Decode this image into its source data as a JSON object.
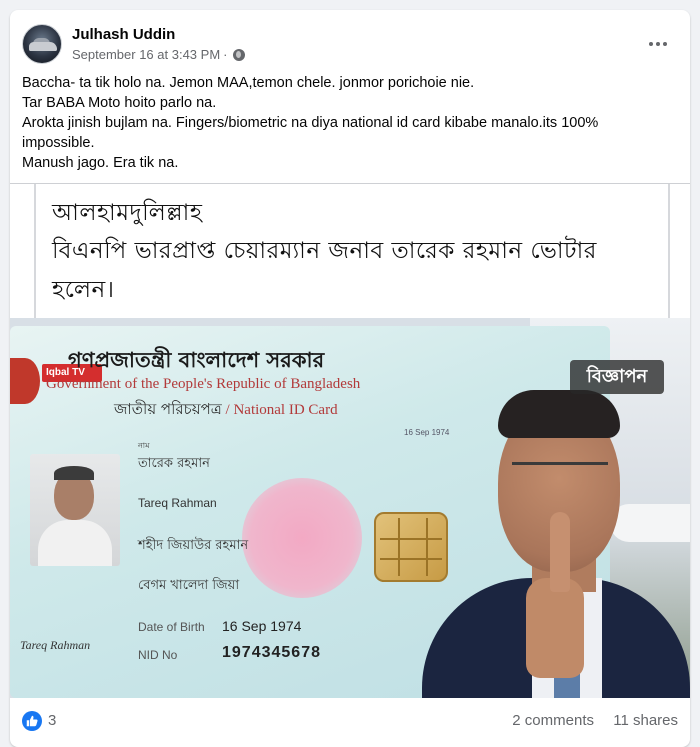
{
  "post": {
    "author": "Julhash Uddin",
    "timestamp": "September 16 at 3:43 PM",
    "separator": "·",
    "privacy_icon": "globe-icon",
    "more_icon": "more-options-icon",
    "text_lines": [
      "Baccha- ta tik holo na. Jemon MAA,temon chele. jonmor porichoie nie.",
      "Tar BABA Moto hoito parlo na.",
      "Arokta jinish bujlam na. Fingers/biometric na diya national id card kibabe manalo.its 100%",
      "impossible.",
      "Manush jago. Era tik na."
    ]
  },
  "image": {
    "headline_lines": [
      "আলহামদুলিল্লাহ",
      "বিএনপি ভারপ্রাপ্ত চেয়ারম্যান জনাব তারেক রহমান ভোটার",
      "হলেন।"
    ],
    "ad_badge": "বিজ্ঞাপন",
    "id_card": {
      "channel_logo": "Iqbal TV",
      "gov_bn": "গণপ্রজাতন্ত্রী বাংলাদেশ সরকার",
      "gov_en": "Government of the People's Republic of Bangladesh",
      "card_title_bn": "জাতীয় পরিচয়পত্র",
      "card_title_en": " / National ID Card",
      "issue_date": "16 Sep 1974",
      "name_label": "নাম",
      "name_bn": "তারেক রহমান",
      "name_en": "Tareq Rahman",
      "father": "শহীদ জিয়াউর রহমান",
      "mother": "বেগম খালেদা জিয়া",
      "dob_label": "Date of Birth",
      "dob": "16 Sep 1974",
      "nid_label": "NID No",
      "nid_no": "1974345678",
      "signature": "Tareq Rahman"
    }
  },
  "footer": {
    "reaction_icon": "like-icon",
    "reaction_count": "3",
    "comments": "2 comments",
    "shares": "11 shares"
  },
  "colors": {
    "brand_blue": "#1877f2",
    "secondary_text": "#65676b",
    "background": "#f0f2f5"
  }
}
